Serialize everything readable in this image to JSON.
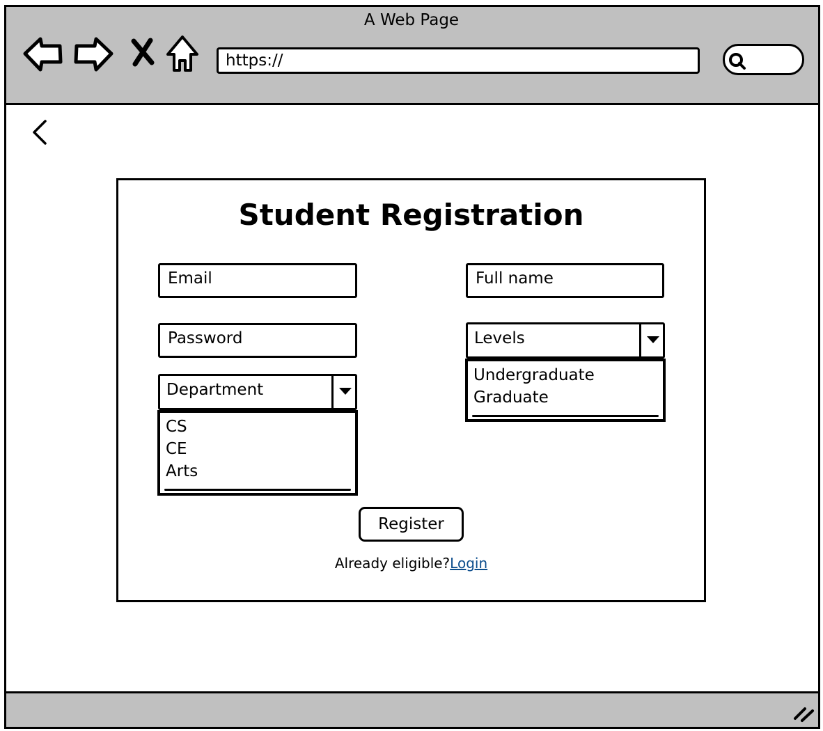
{
  "browser": {
    "title": "A Web Page",
    "url": "https://",
    "icons": [
      "back-icon",
      "forward-icon",
      "close-icon",
      "home-icon",
      "search-icon"
    ]
  },
  "page": {
    "back_icon": "chevron-left-icon",
    "heading": "Student Registration",
    "fields": {
      "email_placeholder": "Email",
      "password_placeholder": "Password",
      "fullname_placeholder": "Full name"
    },
    "department": {
      "label": "Department",
      "options": [
        "CS",
        "CE",
        "Arts"
      ]
    },
    "levels": {
      "label": "Levels",
      "options": [
        "Undergraduate",
        "Graduate"
      ]
    },
    "register_label": "Register",
    "already_text": "Already eligible?",
    "login_label": "Login",
    "link_color": "#0b4d8c"
  }
}
